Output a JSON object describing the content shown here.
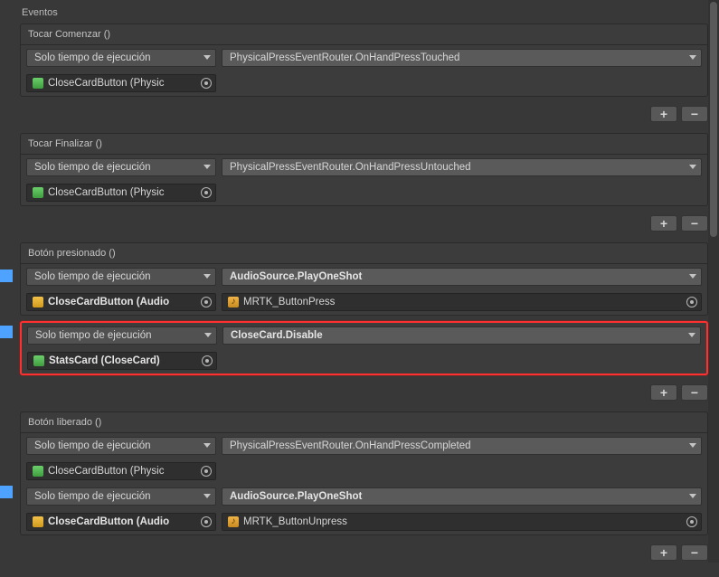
{
  "section_label": "Eventos",
  "runtime_option": "Solo tiempo de ejecución",
  "events": {
    "touch_start": {
      "header": "Tocar Comenzar ()",
      "function": "PhysicalPressEventRouter.OnHandPressTouched",
      "target_label": "CloseCardButton (Physic"
    },
    "touch_end": {
      "header": "Tocar Finalizar ()",
      "function": "PhysicalPressEventRouter.OnHandPressUntouched",
      "target_label": "CloseCardButton (Physic"
    },
    "button_pressed": {
      "header": "Botón presionado ()",
      "rows": [
        {
          "function": "AudioSource.PlayOneShot",
          "target_label": "CloseCardButton (Audio",
          "arg_label": "MRTK_ButtonPress",
          "target_icon": "audio",
          "has_arg": true
        },
        {
          "function": "CloseCard.Disable",
          "target_label": "StatsCard (CloseCard)",
          "target_icon": "script",
          "has_arg": false
        }
      ]
    },
    "button_released": {
      "header": "Botón liberado ()",
      "rows": [
        {
          "function": "PhysicalPressEventRouter.OnHandPressCompleted",
          "target_label": "CloseCardButton (Physic",
          "target_icon": "script",
          "has_arg": false
        },
        {
          "function": "AudioSource.PlayOneShot",
          "target_label": "CloseCardButton (Audio",
          "arg_label": "MRTK_ButtonUnpress",
          "target_icon": "audio",
          "has_arg": true
        }
      ]
    }
  },
  "buttons": {
    "plus": "+",
    "minus": "−"
  }
}
